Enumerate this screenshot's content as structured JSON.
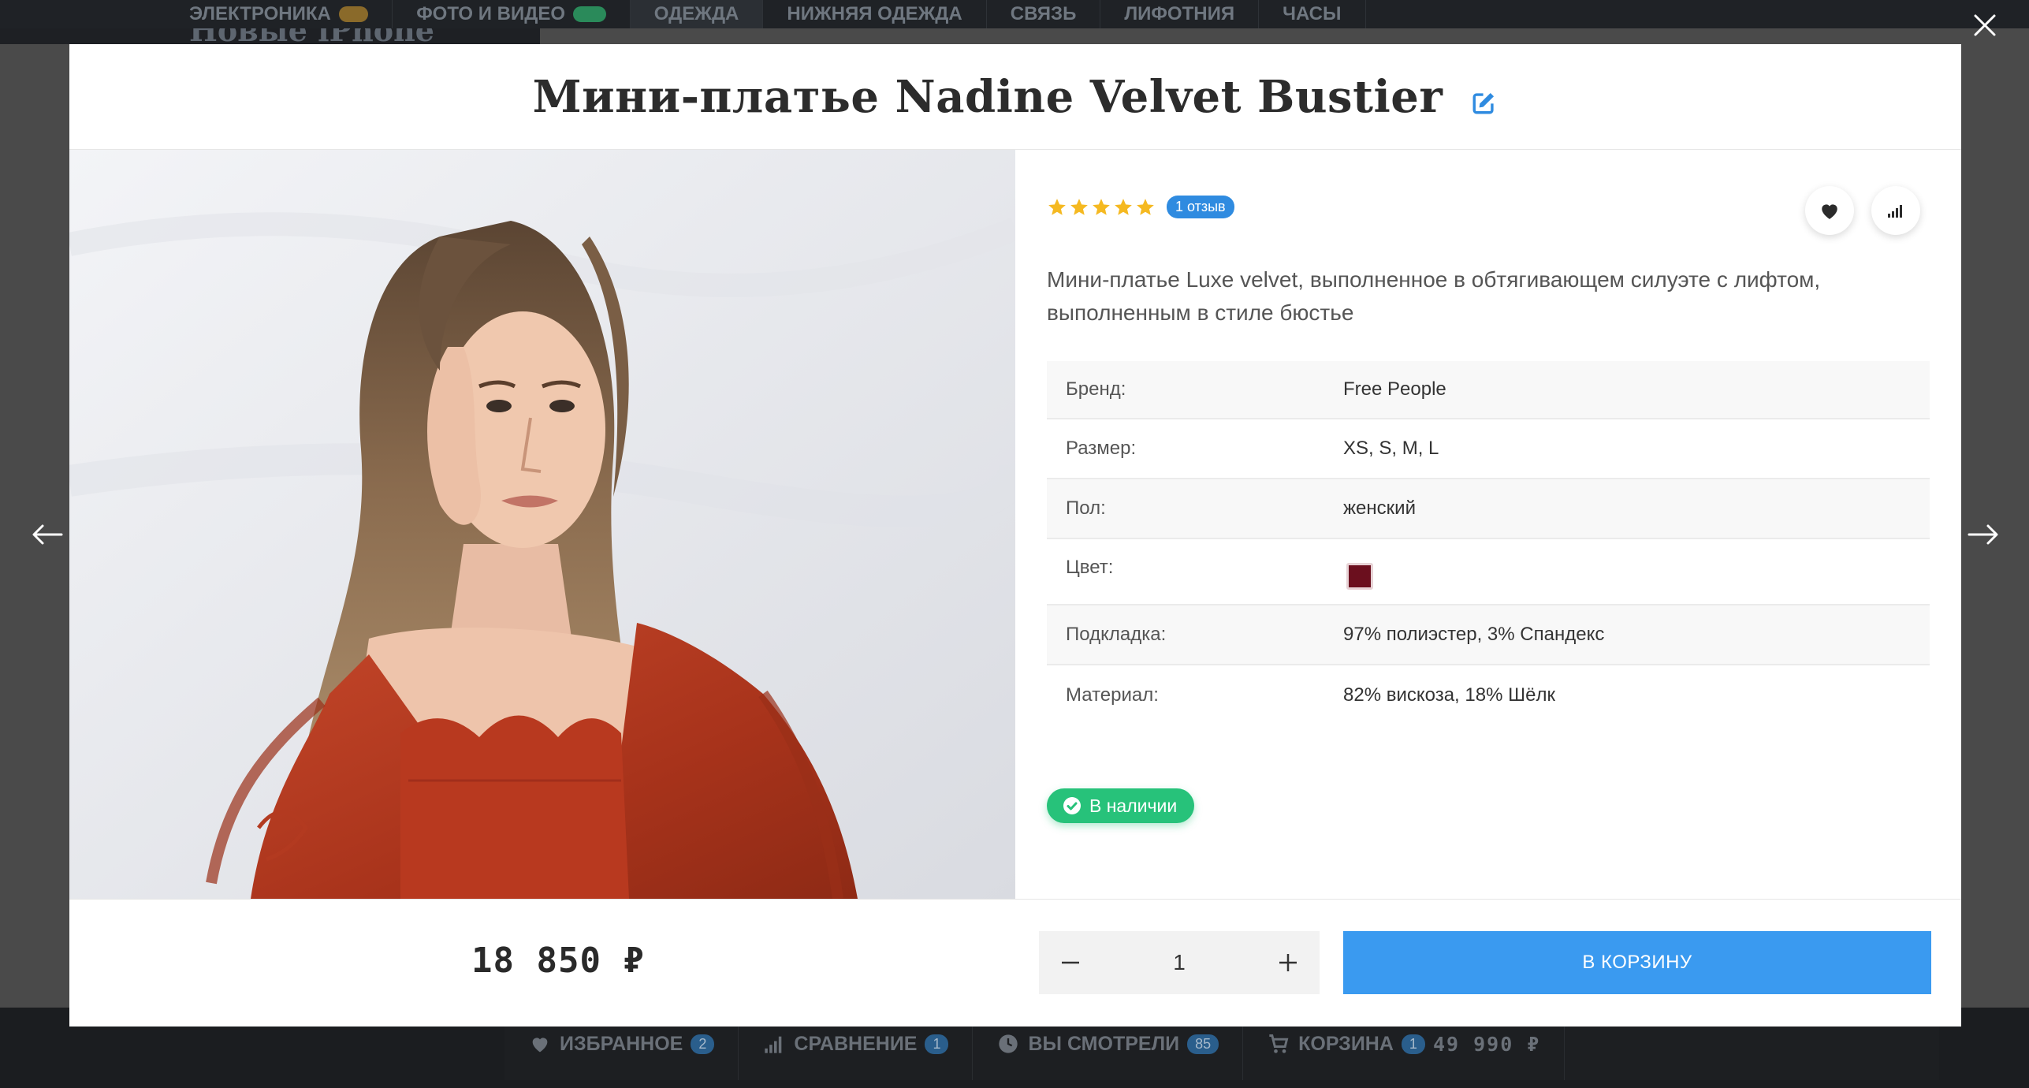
{
  "background": {
    "top_nav": [
      {
        "label": "ЭЛЕКТРОНИКА",
        "badge": "",
        "active": false
      },
      {
        "label": "ФОТО И ВИДЕО",
        "badge": "",
        "active": false
      },
      {
        "label": "ОДЕЖДА",
        "badge": "",
        "active": true
      },
      {
        "label": "НИЖНЯЯ ОДЕЖДА",
        "badge": "",
        "active": false
      },
      {
        "label": "СВЯЗЬ",
        "badge": "",
        "active": false
      },
      {
        "label": "ЛИФОТНИЯ",
        "badge": "",
        "active": false
      },
      {
        "label": "ЧАСЫ",
        "badge": "",
        "active": false
      }
    ],
    "promo_text": "Новые iPhone",
    "bottom_bar": {
      "favorites_label": "ИЗБРАННОЕ",
      "favorites_count": "2",
      "compare_label": "СРАВНЕНИЕ",
      "compare_count": "1",
      "viewed_label": "ВЫ СМОТРЕЛИ",
      "viewed_count": "85",
      "cart_label": "КОРЗИНА",
      "cart_count": "1",
      "cart_sum": "49 990 ₽"
    }
  },
  "modal": {
    "title": "Мини-платье Nadine Velvet Bustier",
    "rating": {
      "stars": 5,
      "max": 5,
      "reviews_label": "1 отзыв"
    },
    "description": "Мини-платье Luxe velvet, выполненное в обтягивающем силуэте с лифтом, выполненным в стиле бюстье",
    "specs": [
      {
        "label": "Бренд:",
        "value": "Free People"
      },
      {
        "label": "Размер:",
        "value": "XS, S, M, L"
      },
      {
        "label": "Пол:",
        "value": "женский"
      },
      {
        "label": "Цвет:",
        "value": "",
        "swatch": "#6b0f1e"
      },
      {
        "label": "Подкладка:",
        "value": "97% полиэстер, 3% Спандекс"
      },
      {
        "label": "Материал:",
        "value": "82% вискоза, 18% Шёлк"
      }
    ],
    "stock_label": "В наличии",
    "price": "18 850 ₽",
    "quantity": "1",
    "add_to_cart_label": "В КОРЗИНУ"
  },
  "colors": {
    "accent_blue": "#3a9af0",
    "badge_blue": "#2f8be0",
    "stock_green": "#27c27a",
    "star_yellow": "#f5b921",
    "dress_red": "#b2391f"
  },
  "icons": {
    "close": "close-icon",
    "prev": "arrow-left-icon",
    "next": "arrow-right-icon",
    "edit": "edit-icon",
    "favorite": "heart-icon",
    "compare": "bar-chart-icon",
    "stock": "check-circle-icon"
  }
}
